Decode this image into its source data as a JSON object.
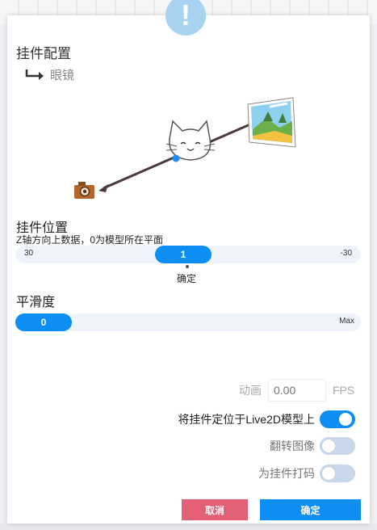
{
  "dialog": {
    "title": "挂件配置",
    "subitem": "眼镜"
  },
  "alert_icon": {
    "glyph": "!",
    "icon": "exclamation-icon"
  },
  "position_section": {
    "title": "挂件位置",
    "hint": "Z轴方向上数据，0为模型所在平面",
    "slider": {
      "min_label": "30",
      "max_label": "-30",
      "value": "1"
    },
    "confirm_label": "确定"
  },
  "smoothness_section": {
    "title": "平滑度",
    "slider": {
      "value": "0",
      "max_label": "Max"
    }
  },
  "animation": {
    "label": "动画",
    "value": "",
    "placeholder": "0.00",
    "unit": "FPS"
  },
  "toggles": [
    {
      "label": "将挂件定位于Live2D模型上",
      "on": true
    },
    {
      "label": "翻转图像",
      "on": false
    },
    {
      "label": "为挂件打码",
      "on": false
    }
  ],
  "buttons": {
    "cancel": "取消",
    "ok": "确定"
  },
  "colors": {
    "accent": "#0d8ef5",
    "cancel": "#e25f76",
    "track": "#eef3fc",
    "badge": "#a8d4f2"
  }
}
